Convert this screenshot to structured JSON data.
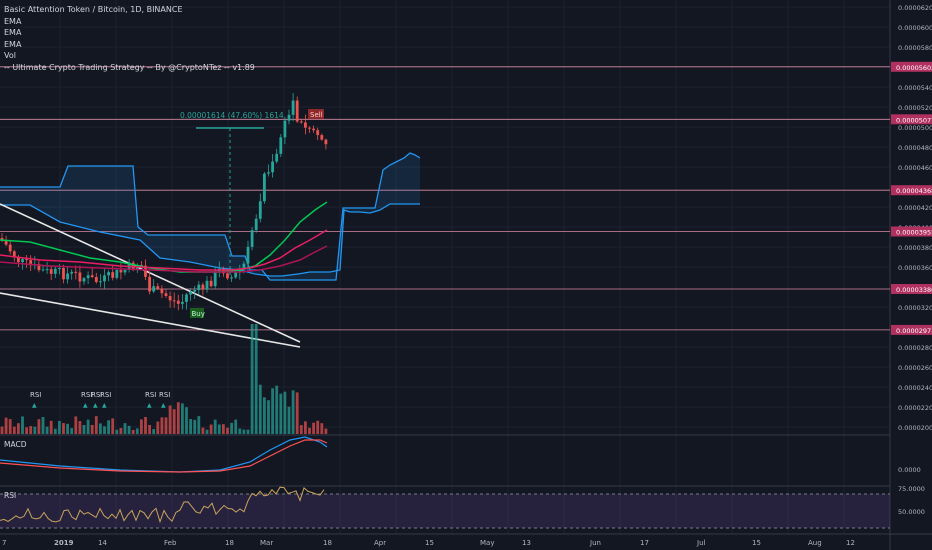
{
  "header": {
    "symbol_title": "Basic Attention Token / Bitcoin, 1D, BINANCE",
    "indicators": [
      "EMA",
      "EMA",
      "EMA",
      "Vol",
      "-- Ultimate Crypto Trading Strategy -- By @CryptoNTez -- v1.89"
    ]
  },
  "panes": {
    "macd_label": "MACD",
    "rsi_label": "RSI"
  },
  "chart_data": {
    "type": "candlestick",
    "price_axis": {
      "ticks": [
        "0.00006200",
        "0.00006000",
        "0.00005800",
        "0.00005400",
        "0.00005200",
        "0.00005000",
        "0.00004800",
        "0.00004600",
        "0.00004200",
        "0.00004000",
        "0.00003800",
        "0.00003600",
        "0.00003200",
        "0.00002800",
        "0.00002600",
        "0.00002400",
        "0.00002200",
        "0.00002000"
      ],
      "range": [
        1.92e-05,
        6.27e-05
      ]
    },
    "levels": [
      {
        "label": "0.00005602",
        "value": 5.602e-05
      },
      {
        "label": "0.00005077",
        "value": 5.077e-05
      },
      {
        "label": "0.00004368",
        "value": 4.368e-05
      },
      {
        "label": "0.00003955",
        "value": 3.955e-05
      },
      {
        "label": "0.00003380",
        "value": 3.38e-05
      },
      {
        "label": "0.00002971",
        "value": 2.971e-05
      }
    ],
    "time_axis": [
      "7",
      "2019",
      "14",
      "Feb",
      "18",
      "Mar",
      "18",
      "Apr",
      "15",
      "May",
      "13",
      "Jun",
      "17",
      "Jul",
      "15",
      "Aug",
      "12"
    ],
    "measure_label": "0.00001614 (47.60%) 1614",
    "markers": {
      "buy": "Buy",
      "sell": "Sell",
      "rsi": "RSI"
    },
    "macd": {
      "tick": "0.0000"
    },
    "rsi": {
      "ticks": [
        "75.0000",
        "50.0000"
      ],
      "overbought": 70,
      "oversold": 30
    },
    "colors": {
      "up": "#26a69a",
      "down": "#ef5350",
      "ema_fast": "#00c853",
      "ema_mid": "#e91e63",
      "ema_slow": "#ad1457",
      "cloud": "#2196f3",
      "level": "#d88ba6",
      "rsi": "#c9a45c",
      "macd": "#2196f3",
      "signal": "#ff5252"
    }
  }
}
